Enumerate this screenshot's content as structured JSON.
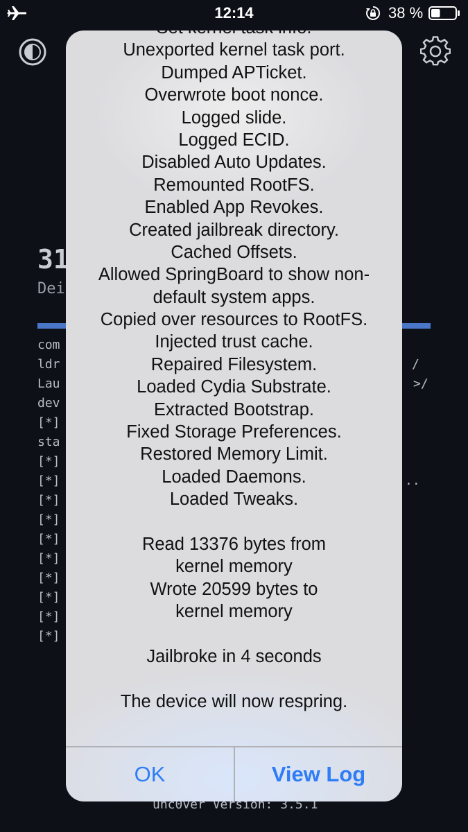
{
  "status_bar": {
    "time": "12:14",
    "battery_percent": "38 %",
    "battery_level": 0.38,
    "icons": [
      "airplane-icon",
      "rotation-lock-icon",
      "battery-icon"
    ]
  },
  "background_app": {
    "big_text": "31",
    "sub_text": "Dei",
    "progress": 1.0,
    "log_lines": [
      {
        "text": "com",
        "tail": ""
      },
      {
        "text": "ldr",
        "tail": "/"
      },
      {
        "text": "Lau",
        "tail": ">/"
      },
      {
        "text": "dev",
        "tail": ""
      },
      {
        "text": "[*]",
        "tail": ""
      },
      {
        "text": "sta",
        "tail": ""
      },
      {
        "text": "[*]",
        "tail": ""
      },
      {
        "text": "[*]",
        "tail": ".."
      },
      {
        "text": "[*]",
        "tail": ""
      },
      {
        "text": "[*]",
        "tail": ""
      },
      {
        "text": "[*]",
        "tail": ""
      },
      {
        "text": "[*]",
        "tail": ""
      },
      {
        "text": "[*]",
        "tail": ""
      },
      {
        "text": "[*]",
        "tail": ""
      },
      {
        "text": "[*]",
        "tail": ""
      },
      {
        "text": "[*]",
        "tail": ""
      }
    ],
    "version": "unc0ver Version: 3.5.1",
    "accent_color": "#4a76c8"
  },
  "alert": {
    "message_lines": [
      "Set kernel task info.",
      "Unexported kernel task port.",
      "Dumped APTicket.",
      "Overwrote boot nonce.",
      "Logged slide.",
      "Logged ECID.",
      "Disabled Auto Updates.",
      "Remounted RootFS.",
      "Enabled App Revokes.",
      "Created jailbreak directory.",
      "Cached Offsets.",
      "Allowed SpringBoard to show non-",
      "default system apps.",
      "Copied over resources to RootFS.",
      "Injected trust cache.",
      "Repaired Filesystem.",
      "Loaded Cydia Substrate.",
      "Extracted Bootstrap.",
      "Fixed Storage Preferences.",
      "Restored Memory Limit.",
      "Loaded Daemons.",
      "Loaded Tweaks.",
      "",
      "Read 13376 bytes from",
      "kernel memory",
      "Wrote 20599 bytes to",
      "kernel memory",
      "",
      "Jailbroke in 4 seconds",
      "",
      "The device will now respring."
    ],
    "ok_label": "OK",
    "view_log_label": "View Log",
    "button_color": "#2e7cf6"
  }
}
